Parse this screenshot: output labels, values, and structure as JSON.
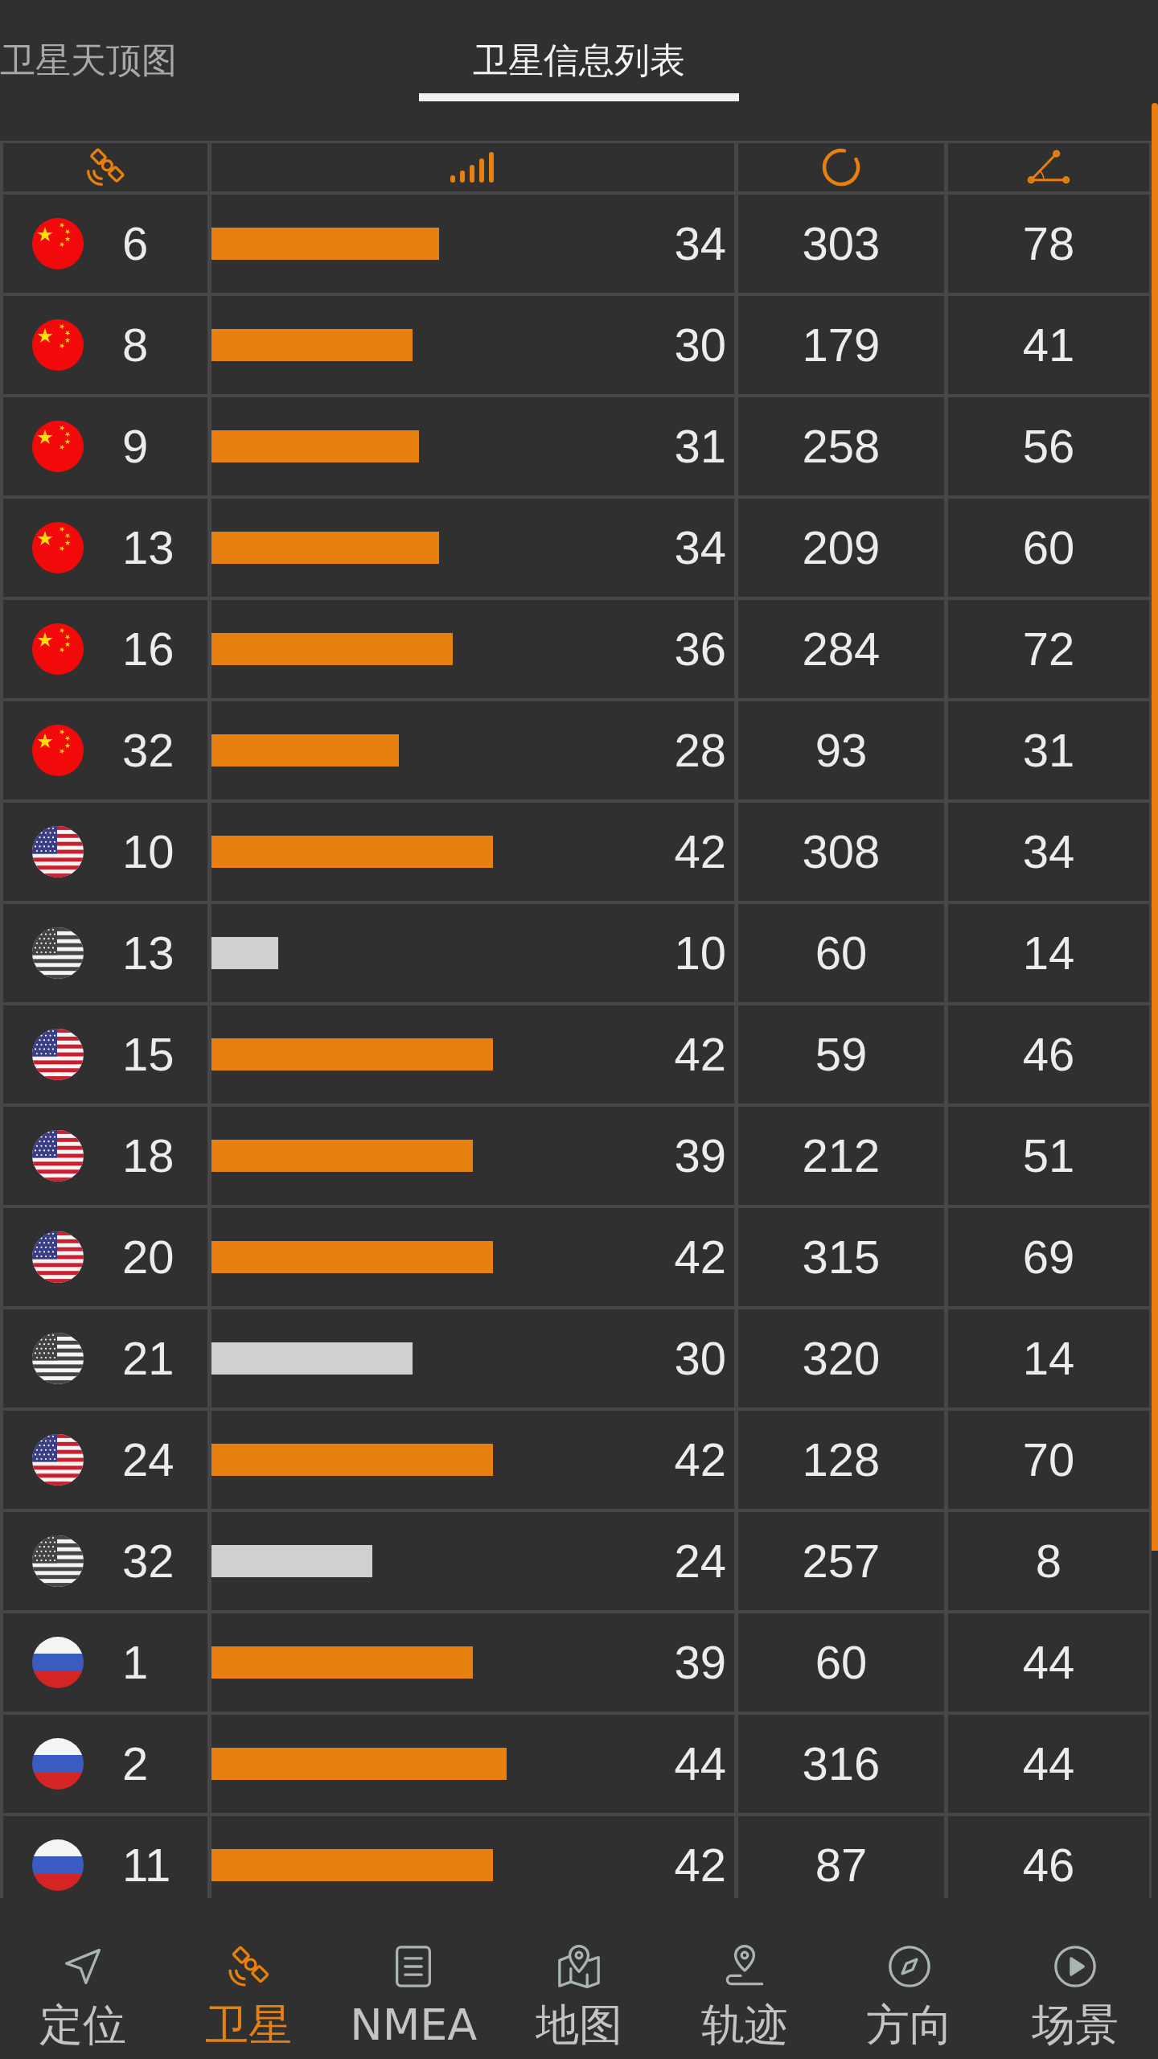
{
  "tabs": [
    {
      "label": "卫星天顶图",
      "selected": false
    },
    {
      "label": "卫星信息列表",
      "selected": true
    }
  ],
  "table": {
    "rows": [
      {
        "kind": "china",
        "number": "6",
        "snr": "34",
        "level": 0.436,
        "in_use": true,
        "azimuth": "303",
        "elevation": "78"
      },
      {
        "kind": "china",
        "number": "8",
        "snr": "30",
        "level": 0.385,
        "in_use": true,
        "azimuth": "179",
        "elevation": "41"
      },
      {
        "kind": "china",
        "number": "9",
        "snr": "31",
        "level": 0.397,
        "in_use": true,
        "azimuth": "258",
        "elevation": "56"
      },
      {
        "kind": "china",
        "number": "13",
        "snr": "34",
        "level": 0.436,
        "in_use": true,
        "azimuth": "209",
        "elevation": "60"
      },
      {
        "kind": "china",
        "number": "16",
        "snr": "36",
        "level": 0.462,
        "in_use": true,
        "azimuth": "284",
        "elevation": "72"
      },
      {
        "kind": "china",
        "number": "32",
        "snr": "28",
        "level": 0.359,
        "in_use": true,
        "azimuth": "93",
        "elevation": "31"
      },
      {
        "kind": "usa",
        "number": "10",
        "snr": "42",
        "level": 0.538,
        "in_use": true,
        "azimuth": "308",
        "elevation": "34"
      },
      {
        "kind": "usa",
        "number": "13",
        "snr": "10",
        "level": 0.128,
        "in_use": false,
        "azimuth": "60",
        "elevation": "14"
      },
      {
        "kind": "usa",
        "number": "15",
        "snr": "42",
        "level": 0.538,
        "in_use": true,
        "azimuth": "59",
        "elevation": "46"
      },
      {
        "kind": "usa",
        "number": "18",
        "snr": "39",
        "level": 0.5,
        "in_use": true,
        "azimuth": "212",
        "elevation": "51"
      },
      {
        "kind": "usa",
        "number": "20",
        "snr": "42",
        "level": 0.538,
        "in_use": true,
        "azimuth": "315",
        "elevation": "69"
      },
      {
        "kind": "usa",
        "number": "21",
        "snr": "30",
        "level": 0.385,
        "in_use": false,
        "azimuth": "320",
        "elevation": "14"
      },
      {
        "kind": "usa",
        "number": "24",
        "snr": "42",
        "level": 0.538,
        "in_use": true,
        "azimuth": "128",
        "elevation": "70"
      },
      {
        "kind": "usa",
        "number": "32",
        "snr": "24",
        "level": 0.308,
        "in_use": false,
        "azimuth": "257",
        "elevation": "8"
      },
      {
        "kind": "russia",
        "number": "1",
        "snr": "39",
        "level": 0.5,
        "in_use": true,
        "azimuth": "60",
        "elevation": "44"
      },
      {
        "kind": "russia",
        "number": "2",
        "snr": "44",
        "level": 0.564,
        "in_use": true,
        "azimuth": "316",
        "elevation": "44"
      },
      {
        "kind": "russia",
        "number": "11",
        "snr": "42",
        "level": 0.538,
        "in_use": true,
        "azimuth": "87",
        "elevation": "46"
      }
    ]
  },
  "nav": {
    "items": [
      {
        "kind": "arrow",
        "label": "定位",
        "selected": false
      },
      {
        "kind": "satellite",
        "label": "卫星",
        "selected": true
      },
      {
        "kind": "document",
        "label": "NMEA",
        "selected": false
      },
      {
        "kind": "map",
        "label": "地图",
        "selected": false
      },
      {
        "kind": "route",
        "label": "轨迹",
        "selected": false
      },
      {
        "kind": "compass",
        "label": "方向",
        "selected": false
      },
      {
        "kind": "play",
        "label": "场景",
        "selected": false
      }
    ]
  }
}
